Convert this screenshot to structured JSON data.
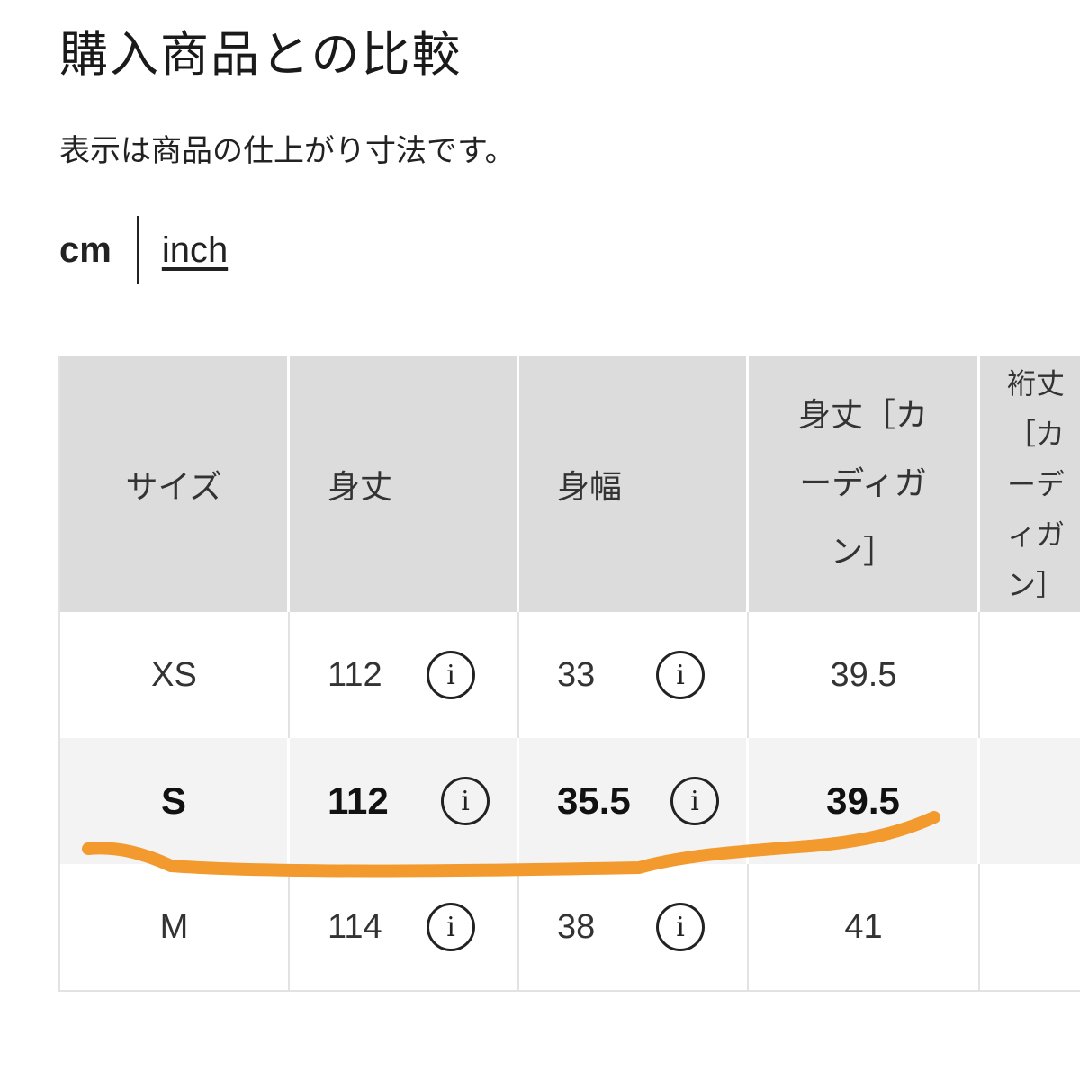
{
  "title": "購入商品との比較",
  "subtitle": "表示は商品の仕上がり寸法です。",
  "units": {
    "cm": "cm",
    "inch": "inch",
    "selected": "cm"
  },
  "table": {
    "headers": [
      "サイズ",
      "身丈",
      "身幅",
      "身丈［カーディガン］",
      "裄丈［カーディガン］"
    ],
    "rows": [
      {
        "size": "XS",
        "length": "112",
        "width": "33",
        "cardigan_length": "39.5",
        "selected": false
      },
      {
        "size": "S",
        "length": "112",
        "width": "35.5",
        "cardigan_length": "39.5",
        "selected": true
      },
      {
        "size": "M",
        "length": "114",
        "width": "38",
        "cardigan_length": "41",
        "selected": false
      }
    ],
    "info_glyph": "i"
  },
  "colors": {
    "header_bg": "#dcdcdc",
    "selected_row_bg": "#f3f3f3",
    "highlight_stroke": "#f39a2e"
  }
}
